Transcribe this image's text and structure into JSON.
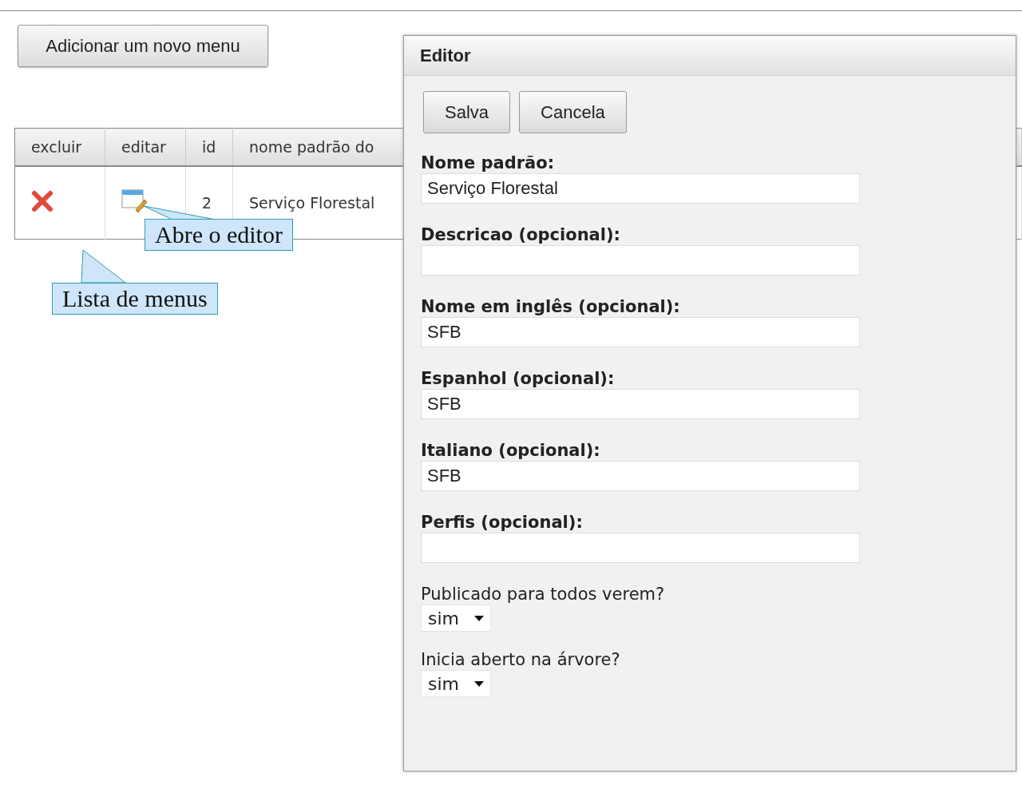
{
  "add_button": "Adicionar um novo menu",
  "table": {
    "columns": [
      "excluir",
      "editar",
      "id",
      "nome padrão do"
    ],
    "rows": [
      {
        "id": "2",
        "name": "Serviço Florestal"
      }
    ]
  },
  "callouts": [
    {
      "text": "Abre o editor"
    },
    {
      "text": "Lista de menus"
    }
  ],
  "editor": {
    "title": "Editor",
    "buttons": [
      "Salva",
      "Cancela"
    ],
    "fields": [
      {
        "kind": "text",
        "label": "Nome padrão:",
        "value": "Serviço Florestal"
      },
      {
        "kind": "text",
        "label": "Descricao (opcional):"
      },
      {
        "kind": "text",
        "label": "Nome em inglês (opcional):",
        "value": "SFB"
      },
      {
        "kind": "text",
        "label": "Espanhol (opcional):",
        "value": "SFB"
      },
      {
        "kind": "text",
        "label": "Italiano (opcional):",
        "value": "SFB"
      },
      {
        "kind": "text",
        "label": "Perfis (opcional):"
      },
      {
        "kind": "select",
        "label": "Publicado para todos verem?",
        "value": "sim"
      },
      {
        "kind": "select",
        "label": "Inicia aberto na árvore?",
        "value": "sim"
      }
    ]
  }
}
